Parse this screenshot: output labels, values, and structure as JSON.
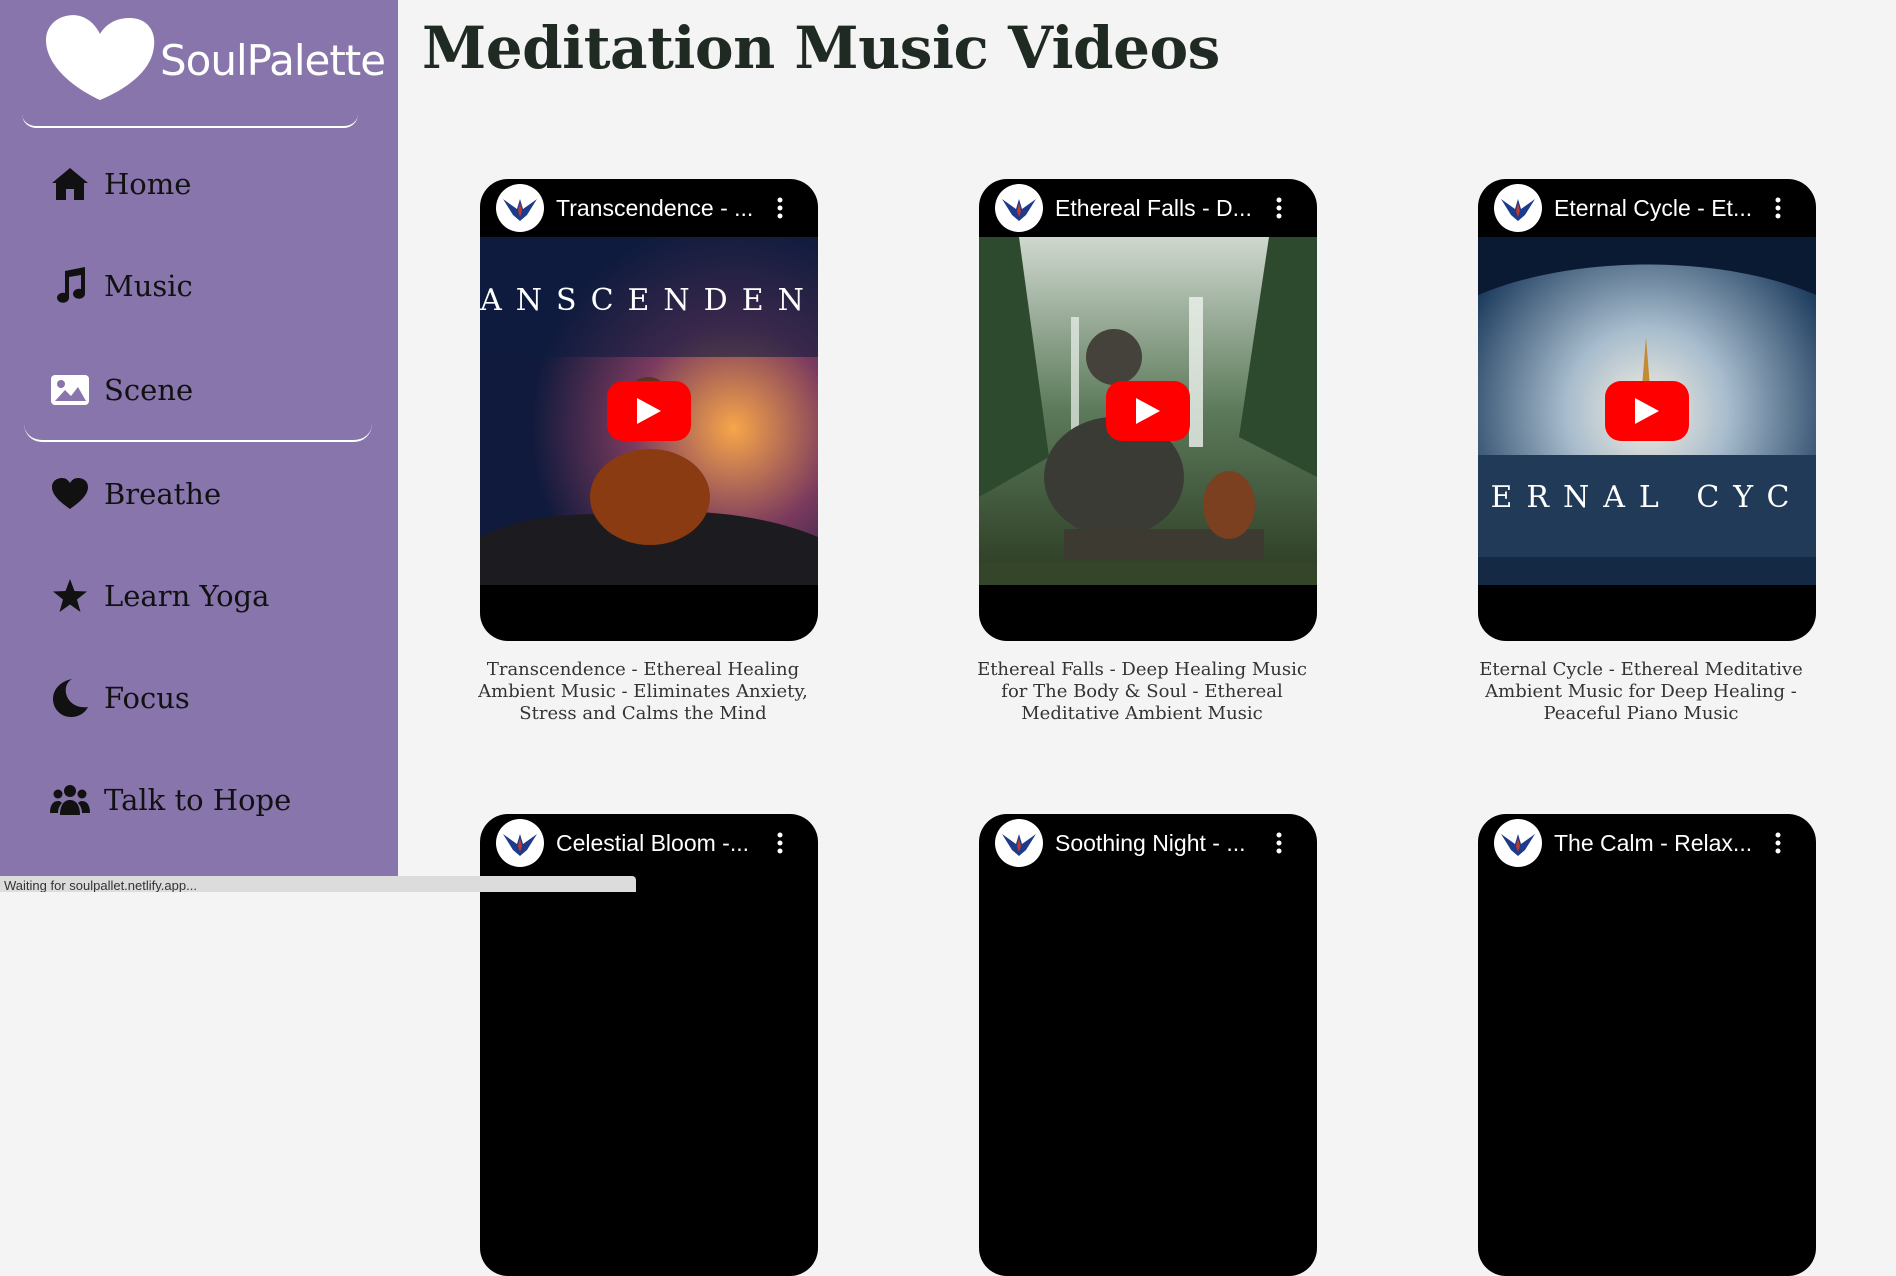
{
  "brand": {
    "name": "SoulPalette",
    "logo": "heart-logo"
  },
  "nav": [
    {
      "label": "Home",
      "icon": "home-icon"
    },
    {
      "label": "Music",
      "icon": "music-note-icon"
    },
    {
      "label": "Scene",
      "icon": "image-icon"
    },
    {
      "label": "Breathe",
      "icon": "heart-icon"
    },
    {
      "label": "Learn Yoga",
      "icon": "star-icon"
    },
    {
      "label": "Focus",
      "icon": "moon-icon"
    },
    {
      "label": "Talk to Hope",
      "icon": "users-icon"
    }
  ],
  "page": {
    "title": "Meditation Music Videos"
  },
  "videos": [
    {
      "title": "Transcendence - ...",
      "overlay": "ANSCENDEN",
      "caption_lines": [
        "Transcendence - Ethereal Healing",
        "Ambient Music - Eliminates Anxiety,",
        "Stress and Calms the Mind"
      ]
    },
    {
      "title": "Ethereal Falls - D...",
      "overlay": "",
      "caption_lines": [
        "Ethereal Falls - Deep Healing Music",
        "for The Body & Soul - Ethereal",
        "Meditative Ambient Music"
      ]
    },
    {
      "title": "Eternal Cycle - Et...",
      "overlay": "ERNAL CYC",
      "caption_lines": [
        "Eternal Cycle - Ethereal Meditative",
        "Ambient Music for Deep Healing -",
        "Peaceful Piano Music"
      ]
    },
    {
      "title": "Celestial Bloom -..."
    },
    {
      "title": "Soothing Night - ..."
    },
    {
      "title": "The Calm - Relax..."
    }
  ],
  "status": {
    "text": "Waiting for soulpallet.netlify.app..."
  },
  "colors": {
    "sidebar": "#8775ac",
    "background": "#f4f4f4",
    "play": "#ff0000"
  }
}
